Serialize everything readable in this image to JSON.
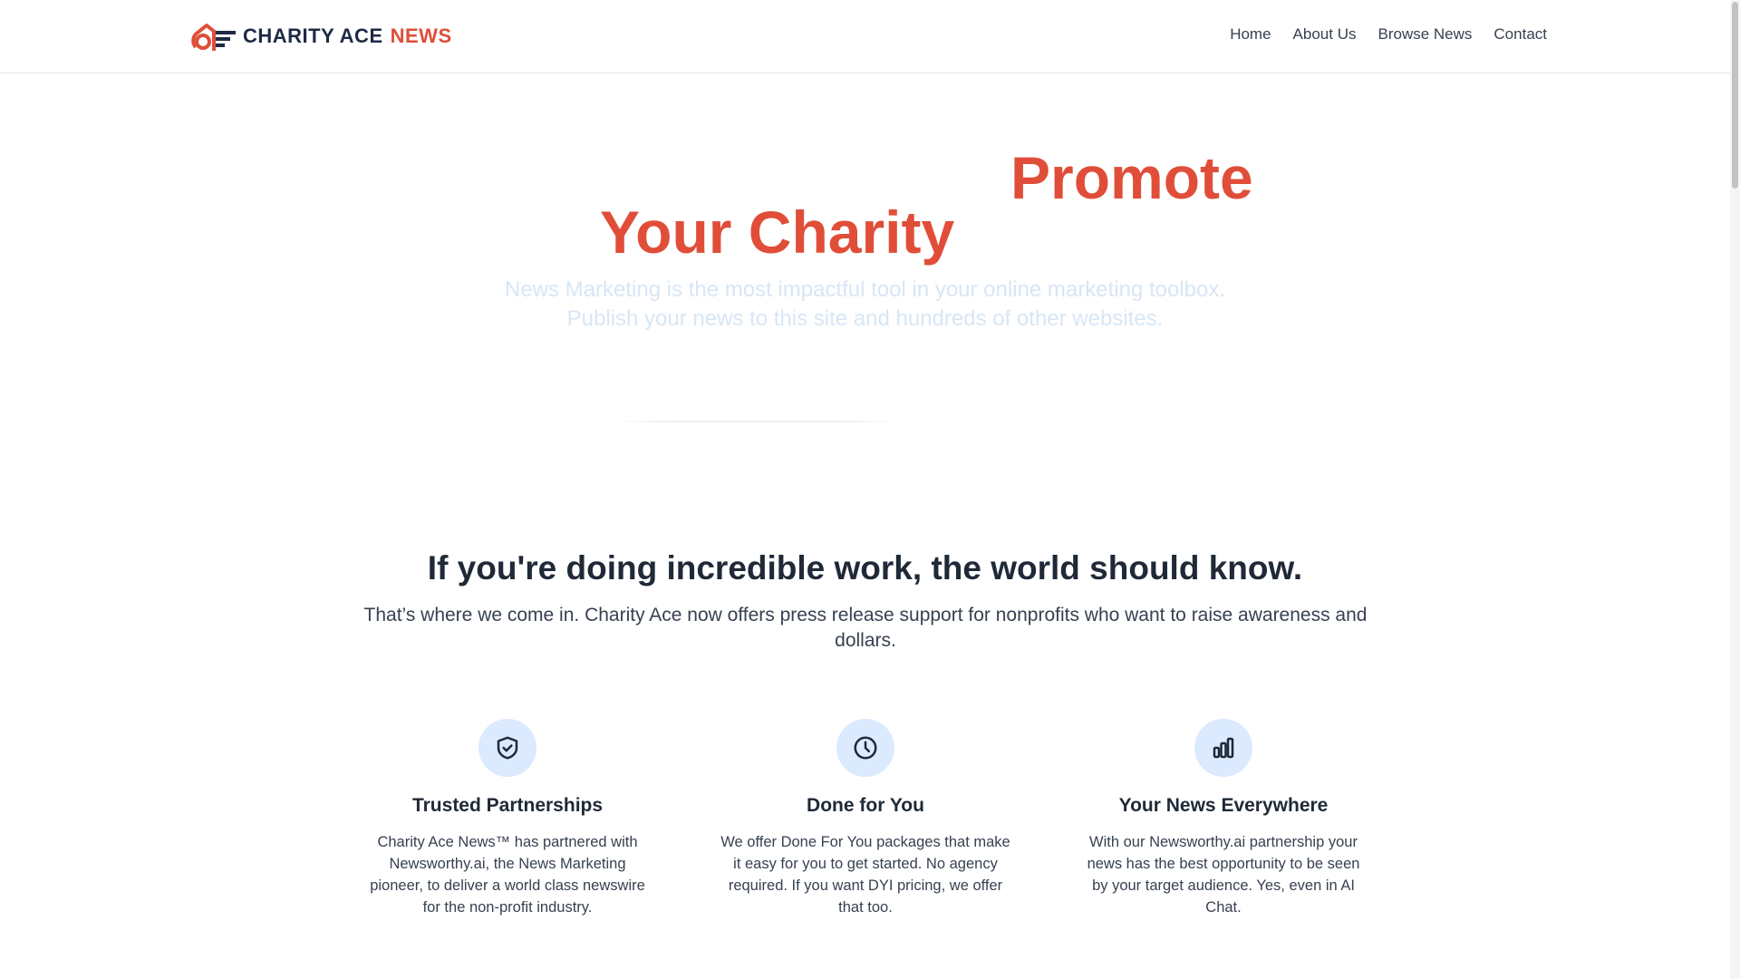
{
  "brand": {
    "name": "CHARITY ACE",
    "accent": "NEWS",
    "primary_color": "#e04e39",
    "dark_color": "#1f2a44"
  },
  "nav": {
    "items": [
      "Home",
      "About Us",
      "Browse News",
      "Contact"
    ]
  },
  "hero": {
    "title_line1": "Promote",
    "title_line2": "Your Charity",
    "subtitle_line1": "News Marketing is the most impactful tool in your online marketing toolbox.",
    "subtitle_line2": "Publish your news to this site and hundreds of other websites."
  },
  "section": {
    "title": "If you're doing incredible work, the world should know.",
    "subtitle": "That’s where we come in. Charity Ace now offers press release support for nonprofits who want to raise awareness and dollars."
  },
  "features": [
    {
      "icon": "shield-check-icon",
      "title": "Trusted Partnerships",
      "text": "Charity Ace News™ has partnered with Newsworthy.ai, the News Marketing pioneer, to deliver a world class newswire for the non-profit industry."
    },
    {
      "icon": "clock-icon",
      "title": "Done for You",
      "text": "We offer Done For You packages that make it easy for you to get started. No agency required. If you want DYI pricing, we offer that too."
    },
    {
      "icon": "bar-chart-icon",
      "title": "Your News Everywhere",
      "text": "With our Newsworthy.ai partnership your news has the best opportunity to be seen by your target audience. Yes, even in AI Chat."
    }
  ]
}
